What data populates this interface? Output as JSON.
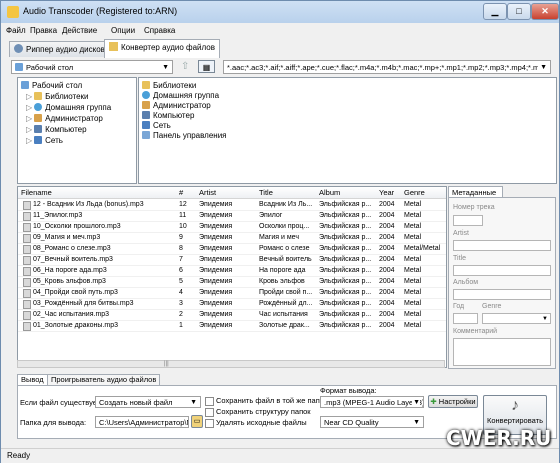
{
  "window": {
    "title": "Audio Transcoder (Registered to:ARN)"
  },
  "menu": [
    "Файл",
    "Правка",
    "Действие",
    "Опции",
    "Справка"
  ],
  "tabs": [
    {
      "label": "Риппер аудио дисков"
    },
    {
      "label": "Конвертер аудио файлов"
    }
  ],
  "toolbar": {
    "location": "Рабочий стол",
    "filter": "*.aac;*.ac3;*.aif;*.aiff;*.ape;*.cue;*.flac;*.m4a;*.m4b;*.mac;*.mp+;*.mp1;*.mp2;*.mp3;*.mp4;*.m"
  },
  "tree": {
    "root": "Рабочий стол",
    "items": [
      "Библиотеки",
      "Домашняя группа",
      "Администратор",
      "Компьютер",
      "Сеть"
    ]
  },
  "browser": {
    "items": [
      "Библиотеки",
      "Домашняя группа",
      "Администратор",
      "Компьютер",
      "Сеть",
      "Панель управления"
    ]
  },
  "table": {
    "columns": [
      "Filename",
      "#",
      "Artist",
      "Title",
      "Album",
      "Year",
      "Genre"
    ],
    "rows": [
      [
        "12 - Всадник Из Льда (bonus).mp3",
        "12",
        "Эпидемия",
        "Всадник Из Ль...",
        "Эльфийская р...",
        "2004",
        "Metal"
      ],
      [
        "11_Эпилог.mp3",
        "11",
        "Эпидемия",
        "Эпилог",
        "Эльфийская р...",
        "2004",
        "Metal"
      ],
      [
        "10_Осколки прошлого.mp3",
        "10",
        "Эпидемия",
        "Осколки проц...",
        "Эльфийская р...",
        "2004",
        "Metal"
      ],
      [
        "09_Магия и меч.mp3",
        "9",
        "Эпидемия",
        "Магия и меч",
        "Эльфийская р...",
        "2004",
        "Metal"
      ],
      [
        "08_Романс о слезе.mp3",
        "8",
        "Эпидемия",
        "Романс о слезе",
        "Эльфийская р...",
        "2004",
        "Metal/Metal"
      ],
      [
        "07_Вечный воитель.mp3",
        "7",
        "Эпидемия",
        "Вечный воитель",
        "Эльфийская р...",
        "2004",
        "Metal"
      ],
      [
        "06_На пороге ада.mp3",
        "6",
        "Эпидемия",
        "На пороге ада",
        "Эльфийская р...",
        "2004",
        "Metal"
      ],
      [
        "05_Кровь эльфов.mp3",
        "5",
        "Эпидемия",
        "Кровь эльфов",
        "Эльфийская р...",
        "2004",
        "Metal"
      ],
      [
        "04_Пройди свой путь.mp3",
        "4",
        "Эпидемия",
        "Пройди свой п...",
        "Эльфийская р...",
        "2004",
        "Metal"
      ],
      [
        "03_Рождённый для битвы.mp3",
        "3",
        "Эпидемия",
        "Рождённый дл...",
        "Эльфийская р...",
        "2004",
        "Metal"
      ],
      [
        "02_Час испытания.mp3",
        "2",
        "Эпидемия",
        "Час испытания",
        "Эльфийская р...",
        "2004",
        "Metal"
      ],
      [
        "01_Золотые драконы.mp3",
        "1",
        "Эпидемия",
        "Золотые драк...",
        "Эльфийская р...",
        "2004",
        "Metal"
      ]
    ]
  },
  "metadata": {
    "tab": "Метаданные",
    "fields": {
      "track": "Номер трека",
      "artist": "Artist",
      "title": "Title",
      "album": "Альбом",
      "year": "Год",
      "genre": "Genre",
      "comment": "Комментарий"
    }
  },
  "bottom_tabs": [
    "Вывод",
    "Проигрыватель аудио файлов"
  ],
  "output": {
    "exists_label": "Если файл существует:",
    "exists_value": "Создать новый файл",
    "folder_label": "Папка для вывода:",
    "folder_value": "C:\\Users\\Администратор\\Mus",
    "cb_same_folder": "Сохранить файл в той же папке",
    "cb_keep_structure": "Сохранить структуру папок",
    "cb_delete_source": "Удалять исходные файлы",
    "format_label": "Формат вывода:",
    "format_value": ".mp3 (MPEG-1 Audio Layer 3)",
    "quality_value": "Near CD Quality",
    "settings_button": "Настройки",
    "convert_button": "Конвертировать"
  },
  "status": "Ready",
  "watermark": "CWER.RU",
  "colors": {
    "folder": "#e8c15a",
    "file": "#d9d9d9",
    "network": "#4a7fc0",
    "accent": "#3b77c7"
  }
}
